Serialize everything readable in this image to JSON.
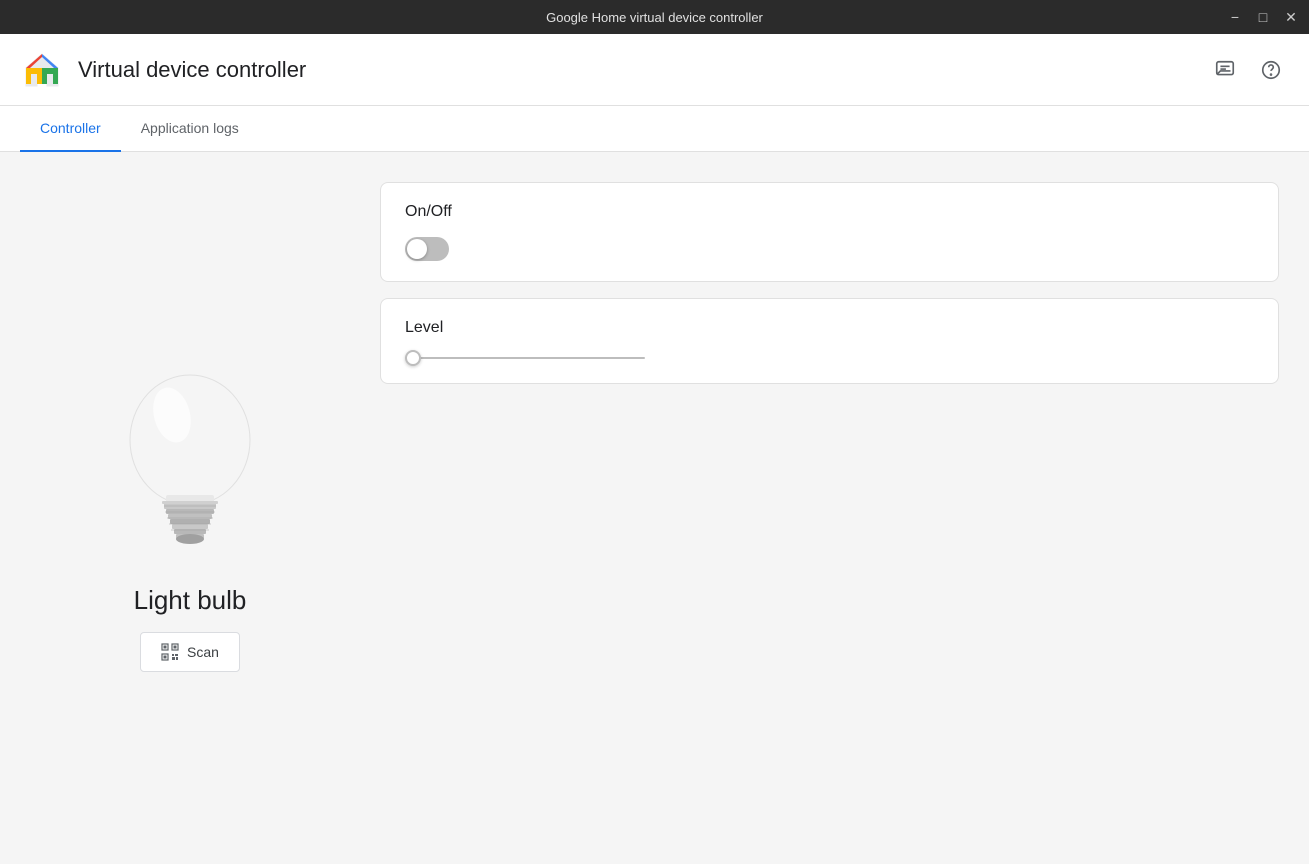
{
  "window": {
    "title": "Google Home virtual device controller"
  },
  "titlebar": {
    "title": "Google Home virtual device controller",
    "minimize_label": "−",
    "maximize_label": "□",
    "close_label": "✕"
  },
  "header": {
    "app_title": "Virtual device controller",
    "feedback_icon": "feedback-icon",
    "help_icon": "help-icon"
  },
  "tabs": [
    {
      "id": "controller",
      "label": "Controller",
      "active": true
    },
    {
      "id": "application-logs",
      "label": "Application logs",
      "active": false
    }
  ],
  "device": {
    "name": "Light bulb",
    "scan_button_label": "Scan"
  },
  "controls": {
    "on_off": {
      "label": "On/Off",
      "value": false
    },
    "level": {
      "label": "Level",
      "value": 0,
      "min": 0,
      "max": 100
    }
  }
}
